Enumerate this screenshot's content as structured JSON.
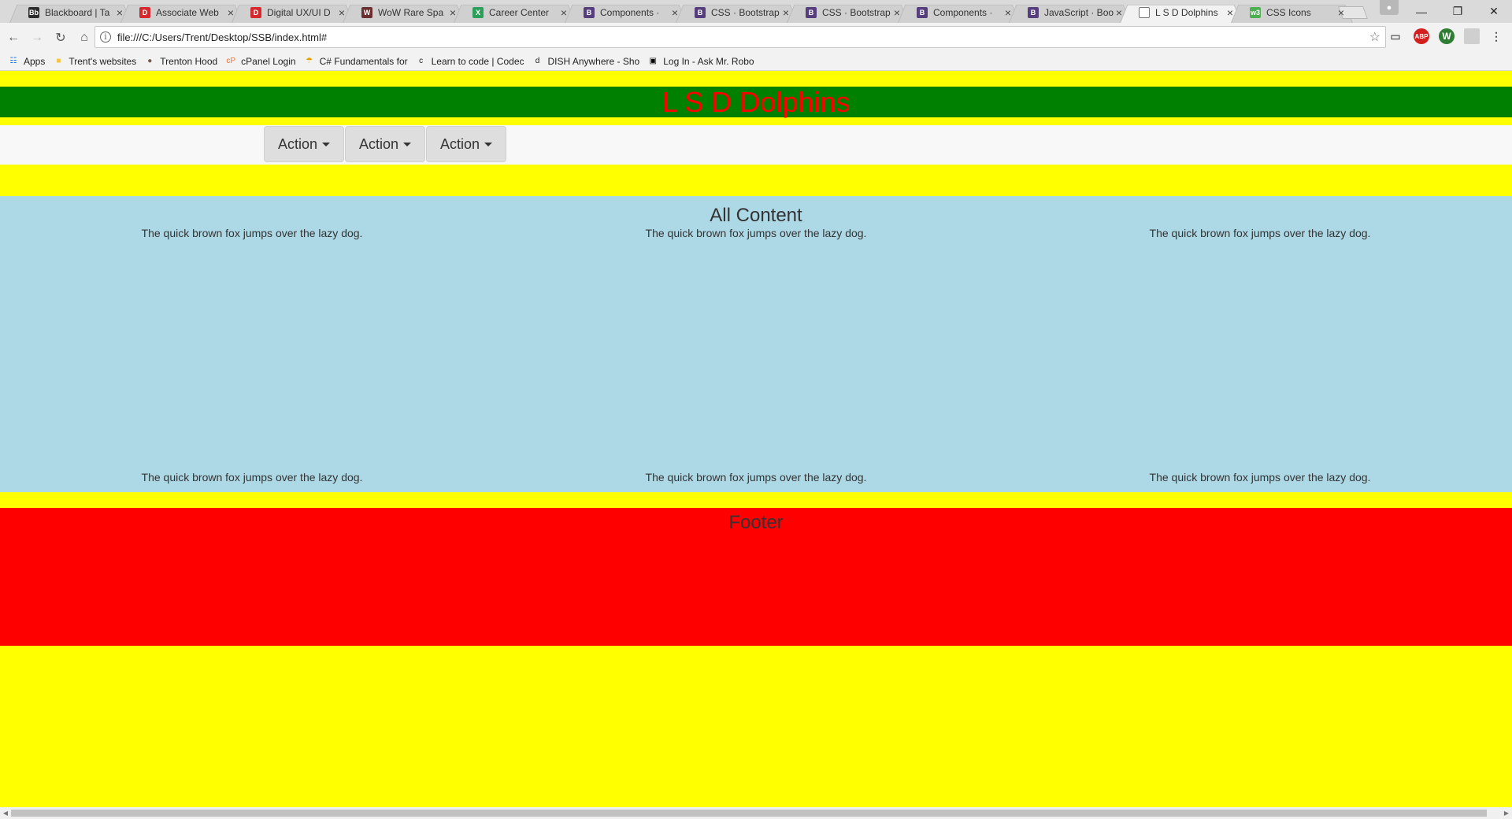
{
  "browser": {
    "tabs": [
      {
        "title": "Blackboard | Ta",
        "favicon": "Bb",
        "color": "#2c2c2c",
        "active": false
      },
      {
        "title": "Associate Web",
        "favicon": "D",
        "color": "#d6282f",
        "active": false
      },
      {
        "title": "Digital UX/UI D",
        "favicon": "D",
        "color": "#d6282f",
        "active": false
      },
      {
        "title": "WoW Rare Spa",
        "favicon": "W",
        "color": "#6b2e2e",
        "active": false
      },
      {
        "title": "Career Center",
        "favicon": "X",
        "color": "#2ca05a",
        "active": false
      },
      {
        "title": "Components ·",
        "favicon": "B",
        "color": "#563d7c",
        "active": false
      },
      {
        "title": "CSS · Bootstrap",
        "favicon": "B",
        "color": "#563d7c",
        "active": false
      },
      {
        "title": "CSS · Bootstrap",
        "favicon": "B",
        "color": "#563d7c",
        "active": false
      },
      {
        "title": "Components ·",
        "favicon": "B",
        "color": "#563d7c",
        "active": false
      },
      {
        "title": "JavaScript · Boo",
        "favicon": "B",
        "color": "#563d7c",
        "active": false
      },
      {
        "title": "L S D Dolphins",
        "favicon": "doc",
        "color": "#ffffff",
        "active": true
      },
      {
        "title": "CSS Icons",
        "favicon": "w3",
        "color": "#4caf50",
        "active": false
      }
    ],
    "url": "file:///C:/Users/Trent/Desktop/SSB/index.html#",
    "bookmarks": [
      {
        "label": "Apps",
        "icon": "apps-grid-icon"
      },
      {
        "label": "Trent's websites",
        "icon": "folder-icon"
      },
      {
        "label": "Trenton Hood",
        "icon": "person-icon"
      },
      {
        "label": "cPanel Login",
        "icon": "cpanel-icon"
      },
      {
        "label": "C# Fundamentals for",
        "icon": "csharp-icon"
      },
      {
        "label": "Learn to code | Codec",
        "icon": "codecademy-icon"
      },
      {
        "label": "DISH Anywhere - Sho",
        "icon": "dish-icon"
      },
      {
        "label": "Log In - Ask Mr. Robo",
        "icon": "mr-robot-icon"
      }
    ]
  },
  "site": {
    "title": "L S D Dolphins",
    "title_color": "#ff0000",
    "header_bg": "#008000",
    "page_bg": "#ffff00",
    "nav": {
      "buttons": [
        {
          "label": "Action"
        },
        {
          "label": "Action"
        },
        {
          "label": "Action"
        }
      ]
    },
    "content": {
      "heading": "All Content",
      "bg": "#add8e6",
      "rows": [
        [
          "The quick brown fox jumps over the lazy dog.",
          "The quick brown fox jumps over the lazy dog.",
          "The quick brown fox jumps over the lazy dog."
        ],
        [
          "The quick brown fox jumps over the lazy dog.",
          "The quick brown fox jumps over the lazy dog.",
          "The quick brown fox jumps over the lazy dog."
        ]
      ]
    },
    "footer": {
      "heading": "Footer",
      "bg": "#ff0000"
    }
  }
}
